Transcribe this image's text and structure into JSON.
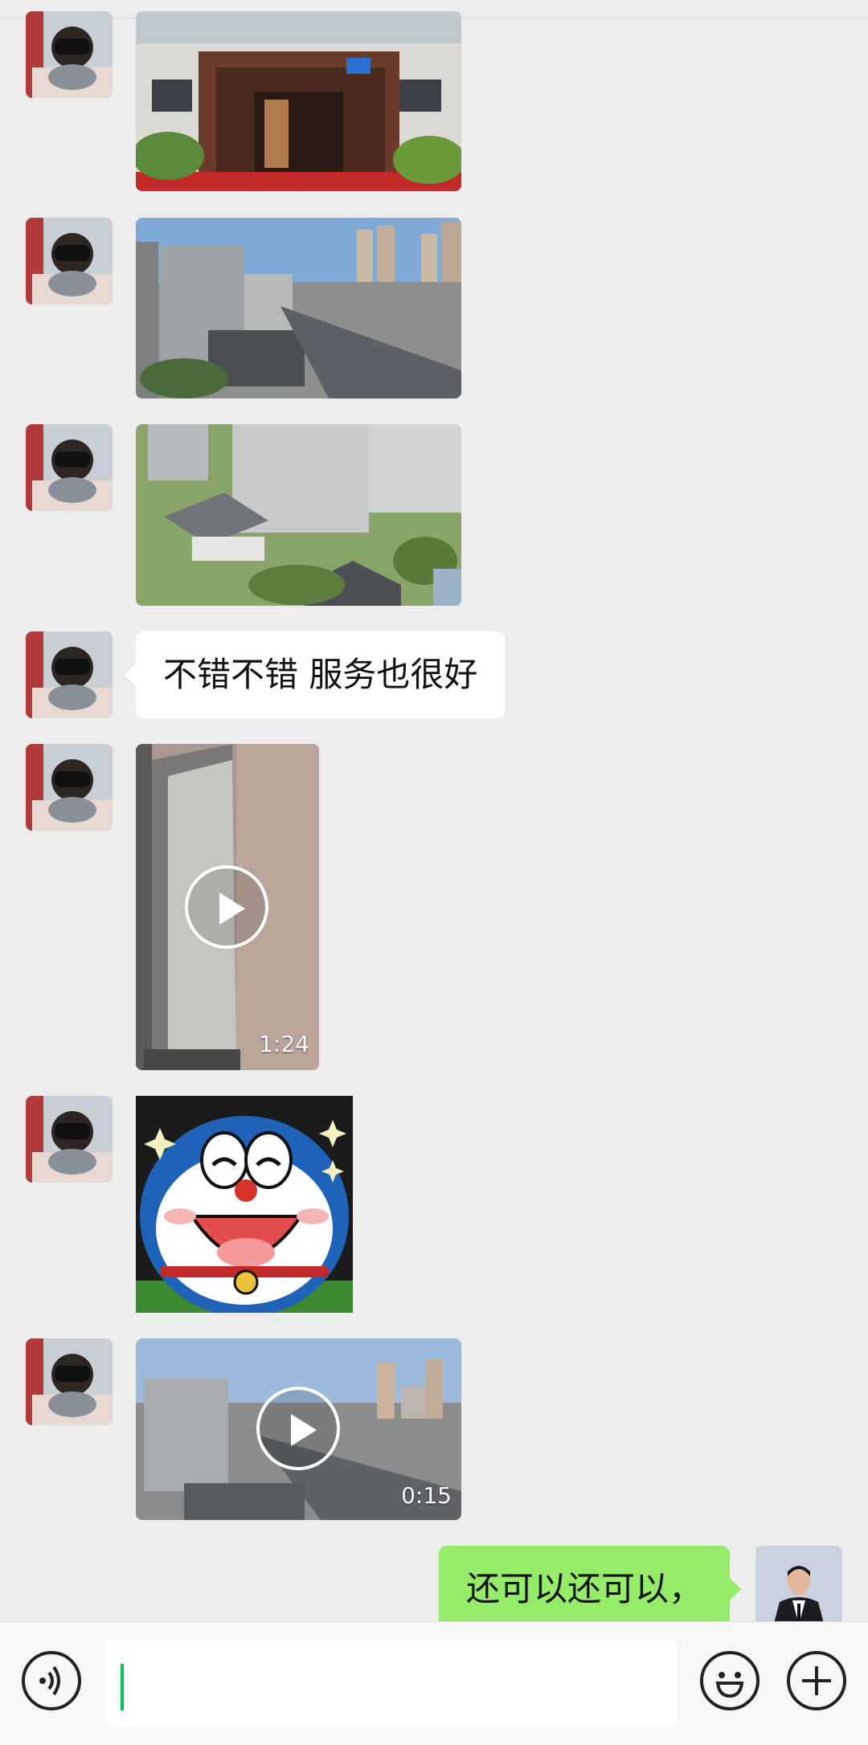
{
  "chat": {
    "messages": [
      {
        "type": "image",
        "from": "other",
        "content": "building entrance photo"
      },
      {
        "type": "image",
        "from": "other",
        "content": "city aerial photo"
      },
      {
        "type": "image",
        "from": "other",
        "content": "residential courtyard photo"
      },
      {
        "type": "text",
        "from": "other",
        "text": "不错不错 服务也很好"
      },
      {
        "type": "video",
        "from": "other",
        "duration": "1:24"
      },
      {
        "type": "sticker",
        "from": "other",
        "content": "doraemon"
      },
      {
        "type": "video",
        "from": "other",
        "duration": "0:15"
      },
      {
        "type": "text",
        "from": "me",
        "text": "还可以还可以，"
      }
    ]
  },
  "input_bar": {
    "icons": [
      "voice-icon",
      "emoji-icon",
      "plus-icon"
    ],
    "value": ""
  },
  "colors": {
    "background": "#ededed",
    "my_bubble": "#95ec69",
    "other_bubble": "#ffffff",
    "cursor": "#07c160"
  }
}
